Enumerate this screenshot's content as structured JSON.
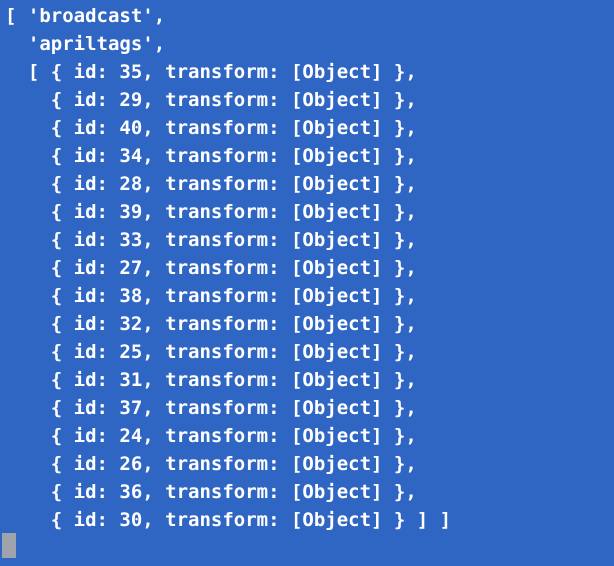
{
  "terminal": {
    "background_color": "#2f66c4",
    "text_color": "#ffffff",
    "cursor_color": "#9fa3ab",
    "lines": [
      "[ 'broadcast',",
      "  'apriltags',",
      "  [ { id: 35, transform: [Object] },",
      "    { id: 29, transform: [Object] },",
      "    { id: 40, transform: [Object] },",
      "    { id: 34, transform: [Object] },",
      "    { id: 28, transform: [Object] },",
      "    { id: 39, transform: [Object] },",
      "    { id: 33, transform: [Object] },",
      "    { id: 27, transform: [Object] },",
      "    { id: 38, transform: [Object] },",
      "    { id: 32, transform: [Object] },",
      "    { id: 25, transform: [Object] },",
      "    { id: 31, transform: [Object] },",
      "    { id: 37, transform: [Object] },",
      "    { id: 24, transform: [Object] },",
      "    { id: 26, transform: [Object] },",
      "    { id: 36, transform: [Object] },",
      "    { id: 30, transform: [Object] } ] ]"
    ]
  }
}
